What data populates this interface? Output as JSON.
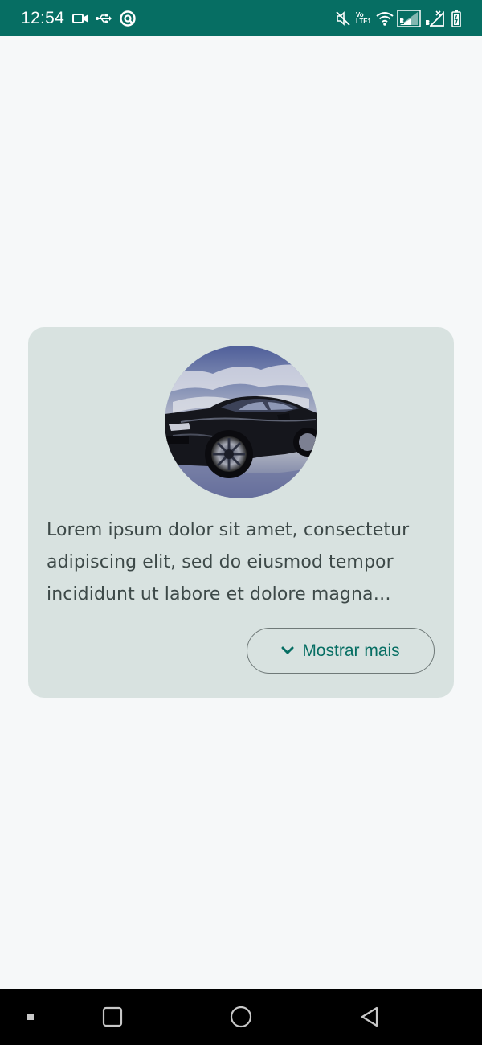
{
  "status_bar": {
    "time": "12:54",
    "left_icons": [
      "video-camera-icon",
      "usb-icon",
      "data-saver-icon"
    ],
    "right_icons": [
      "mute-icon",
      "volte-icon",
      "wifi-icon",
      "signal-sim1-icon",
      "signal-sim2-icon",
      "battery-icon"
    ],
    "volte_top": "Vo",
    "volte_bottom": "LTE1"
  },
  "card": {
    "image_alt": "black sports car",
    "description": "Lorem ipsum dolor sit amet, consectetur adipiscing elit, sed do eiusmod tempor incididunt ut labore et dolore magna aliqua.",
    "button_label": "Mostrar mais",
    "button_icon": "chevron-down-icon"
  },
  "nav_bar": {
    "items": [
      "menu-dot-icon",
      "recents-square-icon",
      "home-circle-icon",
      "back-triangle-icon"
    ]
  },
  "colors": {
    "status_bar": "#066e63",
    "background": "#f6f8f9",
    "card": "#d8e2e0",
    "accent": "#066e63",
    "text": "#3d4948",
    "outline": "#6f7978"
  }
}
